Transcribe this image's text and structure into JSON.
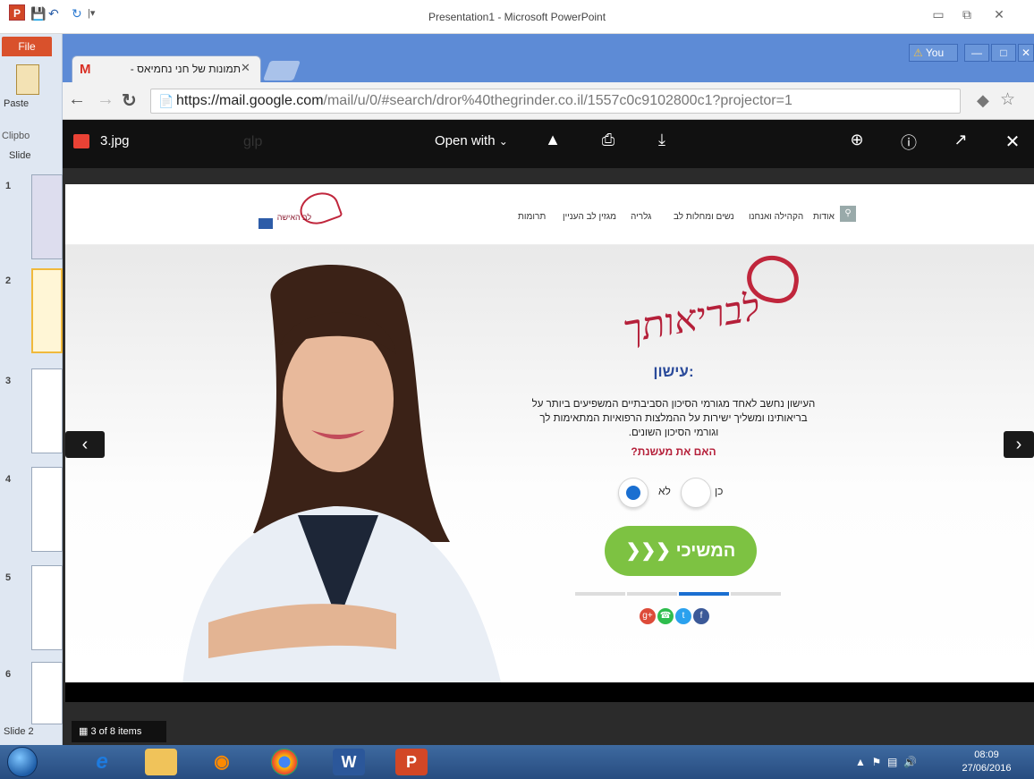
{
  "powerpoint": {
    "title": "Presentation1 - Microsoft PowerPoint",
    "logo": "P",
    "file_tab": "File",
    "paste_label": "Paste",
    "clipboard_label": "Clipbo",
    "slides_label": "Slide",
    "slide_numbers": [
      "1",
      "2",
      "3",
      "4",
      "5",
      "6"
    ],
    "status": "Slide 2"
  },
  "chrome": {
    "tab_title": "תמונות של חני נחמיאס -",
    "tab_favicon": "M",
    "user_badge": "You",
    "url_host": "https://mail.google.com",
    "url_path": "/mail/u/0/#search/dror%40thegrinder.co.il/1557c0c9102800c1?projector=1"
  },
  "viewer": {
    "file_name": "3.jpg",
    "open_with": "Open with",
    "items_counter": "3 of 8 items",
    "ghost_text": "glp"
  },
  "website": {
    "nav": [
      "אודות",
      "הקהילה ואנחנו",
      "נשים ומחלות לב",
      "גלריה",
      "מגזין לב העניין",
      "תרומות"
    ],
    "logo_text": "לב האישה",
    "script_heading": "לבריאותך",
    "section_title": "עישון:",
    "section_body": "העישון נחשב לאחד מגורמי הסיכון הסביבתיים המשפיעים ביותר על בריאותינו ומשליך ישירות על ההמלצות הרפואיות המתאימות לך וגורמי הסיכון השונים.",
    "question": "האם את מעשנת?",
    "radio_yes": "כן",
    "radio_no": "לא",
    "selected_option": "לא",
    "continue_button": "המשיכי ❮❮❮",
    "progress_step": 3,
    "progress_total": 4
  },
  "taskbar": {
    "time": "08:09",
    "date": "27/06/2016"
  },
  "colors": {
    "brand_red": "#b5203a",
    "title_blue": "#2a4a9a",
    "continue_green": "#7dc242",
    "radio_selected": "#1a6fd1"
  }
}
